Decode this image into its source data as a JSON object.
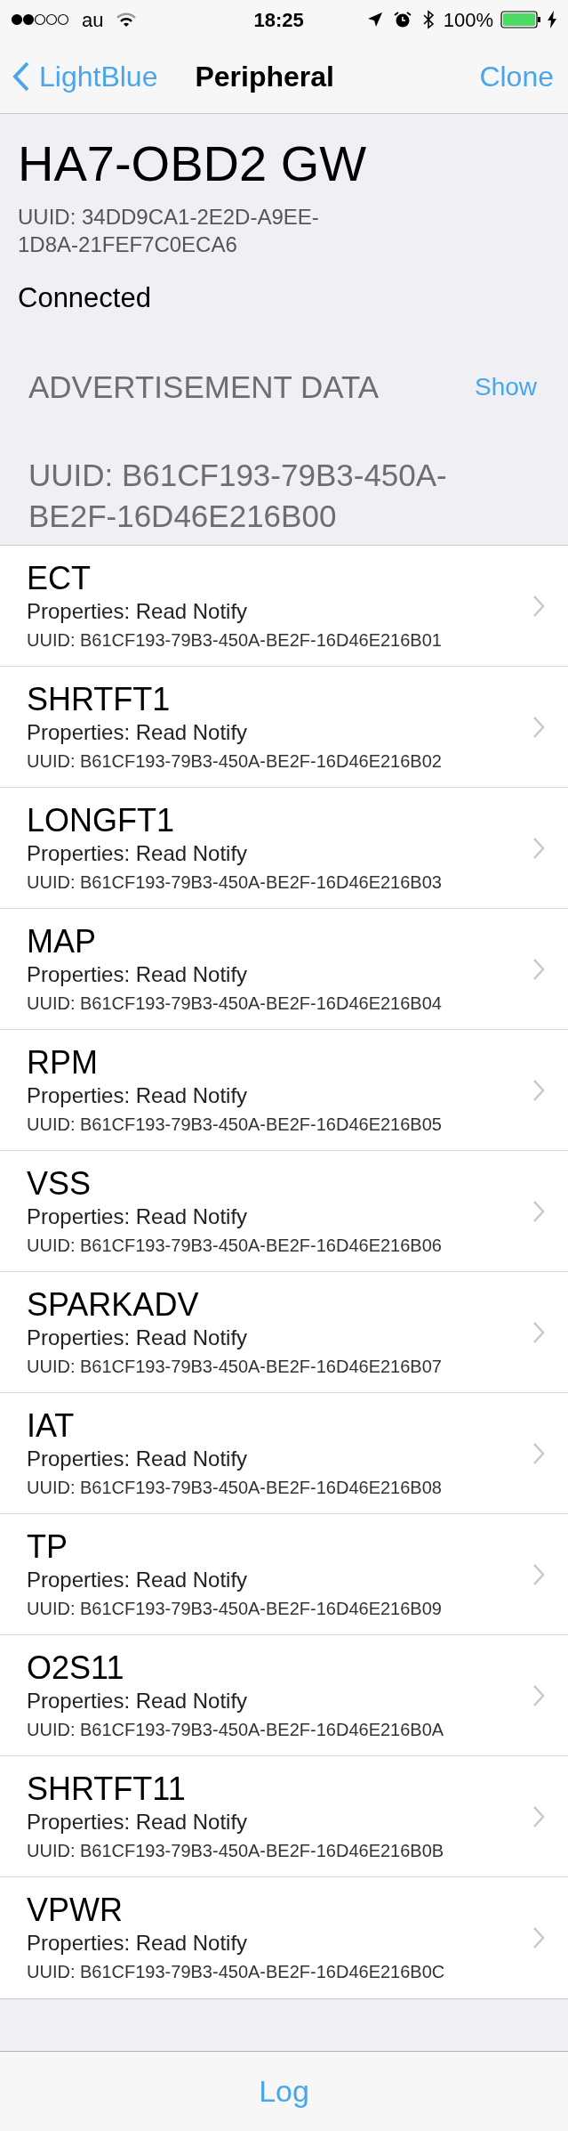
{
  "status_bar": {
    "carrier": "au",
    "time": "18:25",
    "battery": "100%"
  },
  "nav_bar": {
    "back": "LightBlue",
    "title": "Peripheral",
    "action": "Clone"
  },
  "peripheral": {
    "name": "HA7-OBD2 GW",
    "uuid": "UUID: 34DD9CA1-2E2D-A9EE-1D8A-21FEF7C0ECA6",
    "state": "Connected"
  },
  "advertisement": {
    "label": "ADVERTISEMENT DATA",
    "action": "Show"
  },
  "service": {
    "uuid": "UUID: B61CF193-79B3-450A-BE2F-16D46E216B00"
  },
  "characteristics": [
    {
      "name": "ECT",
      "properties": "Properties: Read Notify",
      "uuid": "UUID: B61CF193-79B3-450A-BE2F-16D46E216B01"
    },
    {
      "name": "SHRTFT1",
      "properties": "Properties: Read Notify",
      "uuid": "UUID: B61CF193-79B3-450A-BE2F-16D46E216B02"
    },
    {
      "name": "LONGFT1",
      "properties": "Properties: Read Notify",
      "uuid": "UUID: B61CF193-79B3-450A-BE2F-16D46E216B03"
    },
    {
      "name": "MAP",
      "properties": "Properties: Read Notify",
      "uuid": "UUID: B61CF193-79B3-450A-BE2F-16D46E216B04"
    },
    {
      "name": "RPM",
      "properties": "Properties: Read Notify",
      "uuid": "UUID: B61CF193-79B3-450A-BE2F-16D46E216B05"
    },
    {
      "name": "VSS",
      "properties": "Properties: Read Notify",
      "uuid": "UUID: B61CF193-79B3-450A-BE2F-16D46E216B06"
    },
    {
      "name": "SPARKADV",
      "properties": "Properties: Read Notify",
      "uuid": "UUID: B61CF193-79B3-450A-BE2F-16D46E216B07"
    },
    {
      "name": "IAT",
      "properties": "Properties: Read Notify",
      "uuid": "UUID: B61CF193-79B3-450A-BE2F-16D46E216B08"
    },
    {
      "name": "TP",
      "properties": "Properties: Read Notify",
      "uuid": "UUID: B61CF193-79B3-450A-BE2F-16D46E216B09"
    },
    {
      "name": "O2S11",
      "properties": "Properties: Read Notify",
      "uuid": "UUID: B61CF193-79B3-450A-BE2F-16D46E216B0A"
    },
    {
      "name": "SHRTFT11",
      "properties": "Properties: Read Notify",
      "uuid": "UUID: B61CF193-79B3-450A-BE2F-16D46E216B0B"
    },
    {
      "name": "VPWR",
      "properties": "Properties: Read Notify",
      "uuid": "UUID: B61CF193-79B3-450A-BE2F-16D46E216B0C"
    }
  ],
  "tab_bar": {
    "button": "Log"
  }
}
